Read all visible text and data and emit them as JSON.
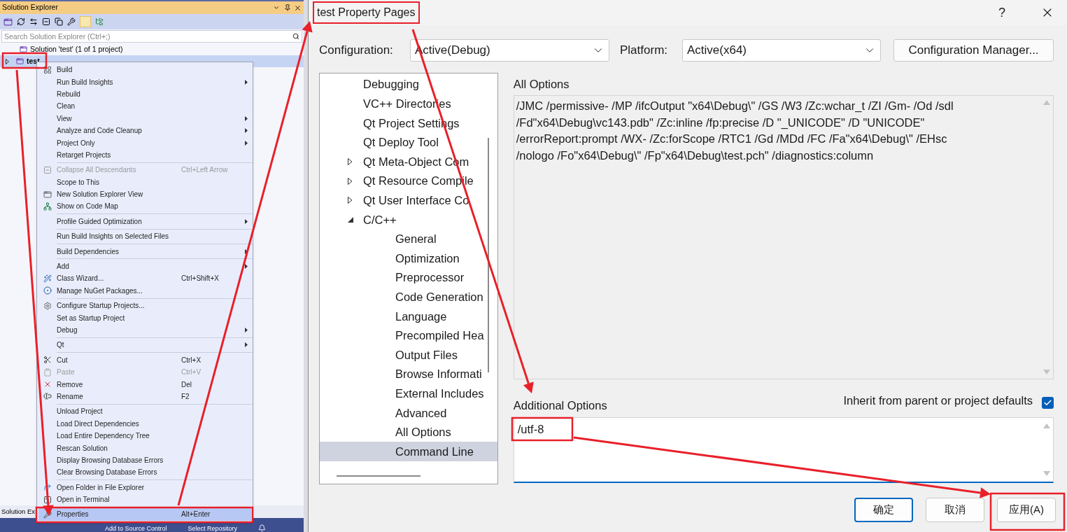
{
  "solution_explorer": {
    "title": "Solution Explorer",
    "search": {
      "placeholder": "Search Solution Explorer (Ctrl+;)"
    },
    "tree": [
      {
        "label": "Solution 'test' (1 of 1 project)",
        "selected": false
      },
      {
        "label": "test",
        "selected": true,
        "expanded": false
      }
    ],
    "bottom_tab": "Solution Ex"
  },
  "status_bar": [
    "Add to Source Control",
    "Select Repository"
  ],
  "context_menu": [
    [
      {
        "label": "Build",
        "selected": false,
        "disabled": false,
        "submenu": false
      },
      {
        "label": "Run Build Insights",
        "selected": false,
        "disabled": false,
        "submenu": true
      },
      {
        "label": "Rebuild",
        "selected": false,
        "disabled": false,
        "submenu": false
      },
      {
        "label": "Clean",
        "selected": false,
        "disabled": false,
        "submenu": false
      },
      {
        "label": "View",
        "selected": false,
        "disabled": false,
        "submenu": true
      },
      {
        "label": "Analyze and Code Cleanup",
        "selected": false,
        "disabled": false,
        "submenu": true
      },
      {
        "label": "Project Only",
        "selected": false,
        "disabled": false,
        "submenu": true
      },
      {
        "label": "Retarget Projects",
        "selected": false,
        "disabled": false,
        "submenu": false
      }
    ],
    [
      {
        "label": "Collapse All Descendants",
        "shortcut": "Ctrl+Left Arrow",
        "selected": false,
        "disabled": true,
        "submenu": false
      },
      {
        "label": "Scope to This",
        "selected": false,
        "disabled": false,
        "submenu": false
      },
      {
        "label": "New Solution Explorer View",
        "selected": false,
        "disabled": false,
        "submenu": false
      },
      {
        "label": "Show on Code Map",
        "selected": false,
        "disabled": false,
        "submenu": false
      }
    ],
    [
      {
        "label": "Profile Guided Optimization",
        "selected": false,
        "disabled": false,
        "submenu": true
      }
    ],
    [
      {
        "label": "Run Build Insights on Selected Files",
        "selected": false,
        "disabled": false,
        "submenu": false
      }
    ],
    [
      {
        "label": "Build Dependencies",
        "selected": false,
        "disabled": false,
        "submenu": true
      }
    ],
    [
      {
        "label": "Add",
        "selected": false,
        "disabled": false,
        "submenu": true
      },
      {
        "label": "Class Wizard...",
        "shortcut": "Ctrl+Shift+X",
        "selected": false,
        "disabled": false,
        "submenu": false
      },
      {
        "label": "Manage NuGet Packages...",
        "selected": false,
        "disabled": false,
        "submenu": false
      }
    ],
    [
      {
        "label": "Configure Startup Projects...",
        "selected": false,
        "disabled": false,
        "submenu": false
      },
      {
        "label": "Set as Startup Project",
        "selected": false,
        "disabled": false,
        "submenu": false
      },
      {
        "label": "Debug",
        "selected": false,
        "disabled": false,
        "submenu": true
      }
    ],
    [
      {
        "label": "Qt",
        "selected": false,
        "disabled": false,
        "submenu": true
      }
    ],
    [
      {
        "label": "Cut",
        "shortcut": "Ctrl+X",
        "selected": false,
        "disabled": false,
        "submenu": false
      },
      {
        "label": "Paste",
        "shortcut": "Ctrl+V",
        "selected": false,
        "disabled": true,
        "submenu": false
      },
      {
        "label": "Remove",
        "shortcut": "Del",
        "selected": false,
        "disabled": false,
        "submenu": false
      },
      {
        "label": "Rename",
        "shortcut": "F2",
        "selected": false,
        "disabled": false,
        "submenu": false
      }
    ],
    [
      {
        "label": "Unload Project",
        "selected": false,
        "disabled": false,
        "submenu": false
      },
      {
        "label": "Load Direct Dependencies",
        "selected": false,
        "disabled": false,
        "submenu": false
      },
      {
        "label": "Load Entire Dependency Tree",
        "selected": false,
        "disabled": false,
        "submenu": false
      },
      {
        "label": "Rescan Solution",
        "selected": false,
        "disabled": false,
        "submenu": false
      },
      {
        "label": "Display Browsing Database Errors",
        "selected": false,
        "disabled": false,
        "submenu": false
      },
      {
        "label": "Clear Browsing Database Errors",
        "selected": false,
        "disabled": false,
        "submenu": false
      }
    ],
    [
      {
        "label": "Open Folder in File Explorer",
        "selected": false,
        "disabled": false,
        "submenu": false
      },
      {
        "label": "Open in Terminal",
        "selected": false,
        "disabled": false,
        "submenu": false
      }
    ],
    [
      {
        "label": "Properties",
        "shortcut": "Alt+Enter",
        "selected": true,
        "disabled": false,
        "submenu": false
      }
    ]
  ],
  "dialog": {
    "title": "test Property Pages",
    "help": "?",
    "configuration": {
      "label": "Configuration:",
      "value": "Active(Debug)"
    },
    "platform": {
      "label": "Platform:",
      "value": "Active(x64)"
    },
    "manager_button": "Configuration Manager...",
    "tree": [
      {
        "label": "Debugging",
        "selected": false
      },
      {
        "label": "VC++ Directories",
        "selected": false
      },
      {
        "label": "Qt Project Settings",
        "selected": false
      },
      {
        "label": "Qt Deploy Tool",
        "selected": false
      },
      {
        "label": "Qt Meta-Object Com",
        "selected": false,
        "expanded": false
      },
      {
        "label": "Qt Resource Compile",
        "selected": false,
        "expanded": false
      },
      {
        "label": "Qt User Interface Co",
        "selected": false,
        "expanded": false
      },
      {
        "label": "C/C++",
        "selected": false,
        "expanded": true,
        "children": [
          {
            "label": "General",
            "selected": false
          },
          {
            "label": "Optimization",
            "selected": false
          },
          {
            "label": "Preprocessor",
            "selected": false
          },
          {
            "label": "Code Generation",
            "selected": false
          },
          {
            "label": "Language",
            "selected": false
          },
          {
            "label": "Precompiled Hea",
            "selected": false
          },
          {
            "label": "Output Files",
            "selected": false
          },
          {
            "label": "Browse Informati",
            "selected": false
          },
          {
            "label": "External Includes",
            "selected": false
          },
          {
            "label": "Advanced",
            "selected": false
          },
          {
            "label": "All Options",
            "selected": false
          },
          {
            "label": "Command Line",
            "selected": true
          }
        ]
      }
    ],
    "all_options": {
      "label": "All Options",
      "lines": [
        "/JMC /permissive- /MP /ifcOutput \"x64\\Debug\\\" /GS /W3 /Zc:wchar_t /ZI /Gm- /Od /sdl",
        "/Fd\"x64\\Debug\\vc143.pdb\" /Zc:inline /fp:precise /D \"_UNICODE\" /D \"UNICODE\"",
        "/errorReport:prompt /WX- /Zc:forScope /RTC1 /Gd /MDd /FC /Fa\"x64\\Debug\\\" /EHsc",
        "/nologo /Fo\"x64\\Debug\\\" /Fp\"x64\\Debug\\test.pch\" /diagnostics:column"
      ]
    },
    "additional_options": {
      "label": "Additional Options",
      "value": "/utf-8"
    },
    "inherit": {
      "label": "Inherit from parent or project defaults",
      "checked": true
    },
    "buttons": [
      {
        "label": "确定",
        "default": true
      },
      {
        "label": "取消",
        "default": false
      },
      {
        "label": "应用(A)",
        "default": false
      }
    ]
  }
}
